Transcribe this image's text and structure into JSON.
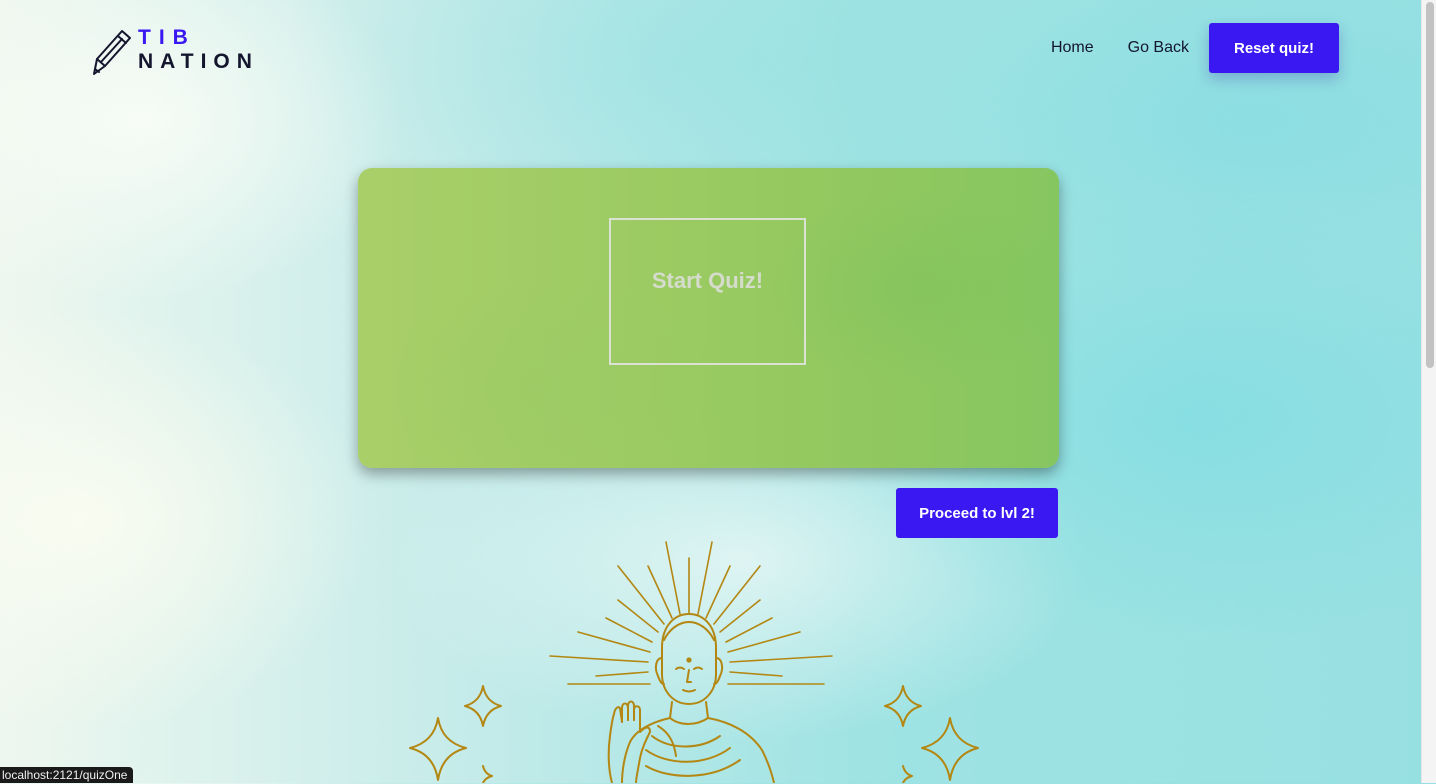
{
  "header": {
    "logo": {
      "line1": "TIB",
      "line2": "NATION",
      "icon": "pencil-icon"
    },
    "nav": {
      "home": "Home",
      "go_back": "Go Back",
      "reset": "Reset quiz!"
    }
  },
  "quiz": {
    "start_label": "Start Quiz!",
    "proceed_label": "Proceed to lvl 2!"
  },
  "illustration": {
    "name": "buddha-illustration",
    "color": "#b38712"
  },
  "status_bar": {
    "url": "localhost:2121/quizOne"
  },
  "colors": {
    "accent": "#3a18f2",
    "card_green": "#9dcb63",
    "logo_dark": "#14162e"
  }
}
